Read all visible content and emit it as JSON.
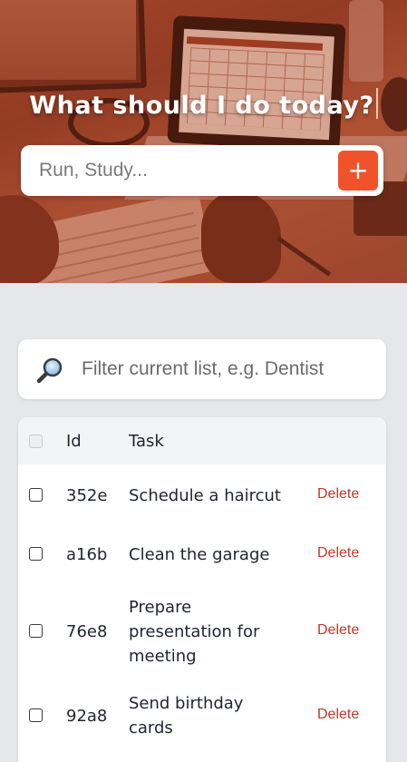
{
  "hero": {
    "title": "What should I do today?",
    "input_placeholder": "Run, Study...",
    "add_button_label": "+"
  },
  "filter": {
    "icon": "magnifier-icon",
    "placeholder": "Filter current list, e.g. Dentist"
  },
  "table": {
    "columns": [
      "Id",
      "Task"
    ],
    "rows": [
      {
        "id": "352e",
        "task": "Schedule a haircut",
        "action": "Delete"
      },
      {
        "id": "a16b",
        "task": "Clean the garage",
        "action": "Delete"
      },
      {
        "id": "76e8",
        "task": "Prepare presentation for meeting",
        "action": "Delete"
      },
      {
        "id": "92a8",
        "task": "Send birthday cards",
        "action": "Delete"
      }
    ]
  },
  "colors": {
    "accent": "#f0532a",
    "delete": "#c0392b",
    "background": "#e5e7eb"
  }
}
